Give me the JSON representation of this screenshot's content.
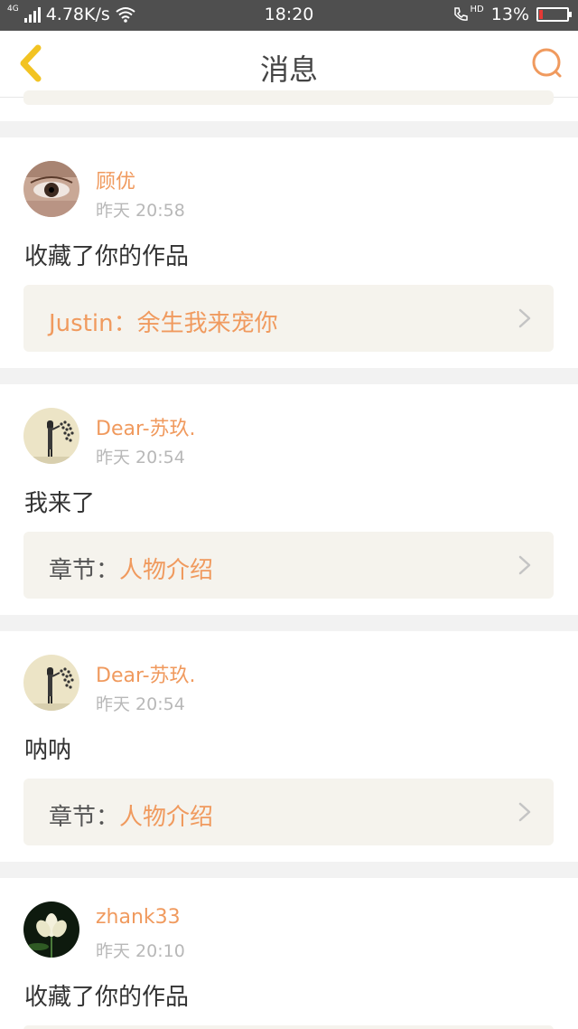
{
  "status_bar": {
    "network_type": "4G",
    "speed": "4.78K/s",
    "time": "18:20",
    "hd_badge": "HD",
    "battery_percent": "13%",
    "battery_level": 0.13,
    "battery_color": "#e53935"
  },
  "nav": {
    "title": "消息",
    "back_icon": "chevron-left-icon",
    "search_icon": "search-icon",
    "accent": "#f09a5e",
    "back_color": "#f2c322"
  },
  "messages": [
    {
      "username": "顾优",
      "time": "昨天 20:58",
      "text": "收藏了你的作品",
      "ref_prefix": "Justin：",
      "ref_title": "余生我来宠你",
      "avatar_icon": "eye-photo-avatar"
    },
    {
      "username": "Dear-苏玖.",
      "time": "昨天 20:54",
      "text": "我来了",
      "ref_prefix": "章节：",
      "ref_title": "人物介绍",
      "avatar_icon": "girl-wall-avatar"
    },
    {
      "username": "Dear-苏玖.",
      "time": "昨天 20:54",
      "text": "呐呐",
      "ref_prefix": "章节：",
      "ref_title": "人物介绍",
      "avatar_icon": "girl-wall-avatar"
    },
    {
      "username": "zhank33",
      "time": "昨天 20:10",
      "text": "收藏了你的作品",
      "avatar_icon": "lotus-avatar"
    }
  ]
}
